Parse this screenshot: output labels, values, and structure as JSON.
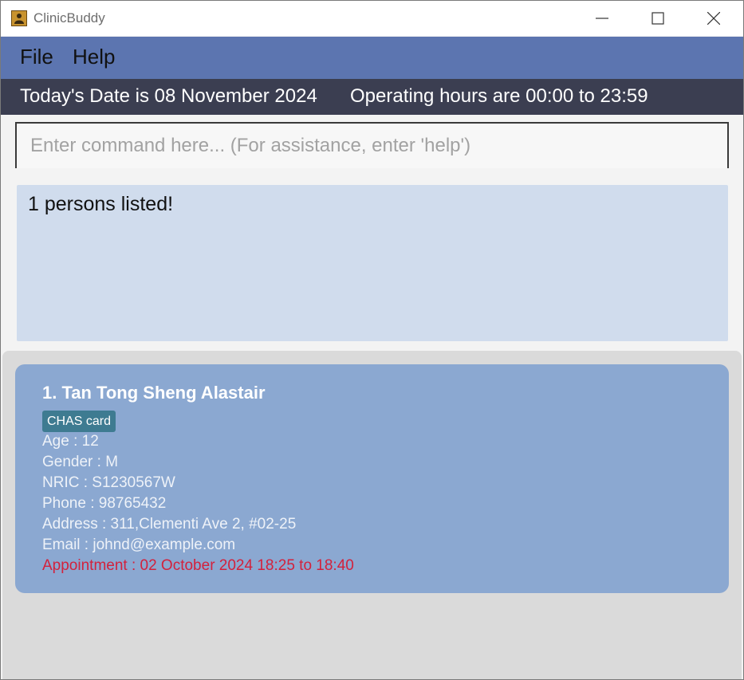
{
  "window": {
    "title": "ClinicBuddy"
  },
  "menu": {
    "file": "File",
    "help": "Help"
  },
  "status": {
    "date_text": "Today's Date is 08 November 2024",
    "hours_text": "Operating hours are 00:00 to 23:59"
  },
  "command": {
    "placeholder": "Enter command here... (For assistance, enter 'help')",
    "value": ""
  },
  "result": {
    "message": "1 persons listed!"
  },
  "persons": [
    {
      "name": "1. Tan Tong Sheng Alastair",
      "tag": "CHAS card",
      "age": "Age : 12",
      "gender": "Gender : M",
      "nric": "NRIC : S1230567W",
      "phone": "Phone : 98765432",
      "address": "Address : 311,Clementi Ave 2, #02-25",
      "email": "Email : johnd@example.com",
      "appointment": "Appointment : 02 October 2024 18:25 to 18:40"
    }
  ],
  "colors": {
    "menubar": "#5c75b0",
    "statusbar": "#3b3e51",
    "result_box": "#d0dced",
    "card": "#8ba8d1",
    "tag": "#3e7b91",
    "appointment": "#d3213c"
  },
  "icons": {
    "app": "person-icon",
    "minimize": "minimize-icon",
    "maximize": "maximize-icon",
    "close": "close-icon"
  }
}
